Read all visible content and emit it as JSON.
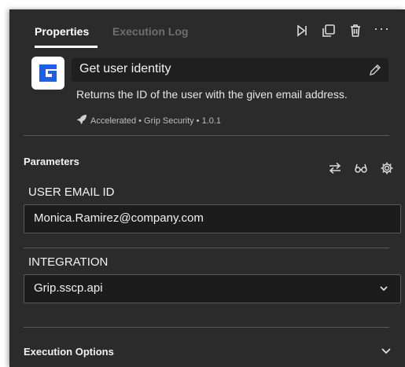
{
  "tabs": {
    "properties": "Properties",
    "execution_log": "Execution Log"
  },
  "toolbar": {
    "run_icon": "step-run-icon",
    "copy_icon": "copy-icon",
    "delete_icon": "trash-icon",
    "more_label": "···"
  },
  "action": {
    "title": "Get user identity",
    "description": "Returns the ID of the user with the given email address.",
    "meta": "Accelerated • Grip Security • 1.0.1",
    "logo_color": "#1e5fe6"
  },
  "parameters": {
    "heading": "Parameters",
    "email_label": "USER EMAIL ID",
    "email_value": "Monica.Ramirez@company.com",
    "integration_label": "INTEGRATION",
    "integration_value": "Grip.sscp.api"
  },
  "execution_options": {
    "heading": "Execution Options"
  }
}
